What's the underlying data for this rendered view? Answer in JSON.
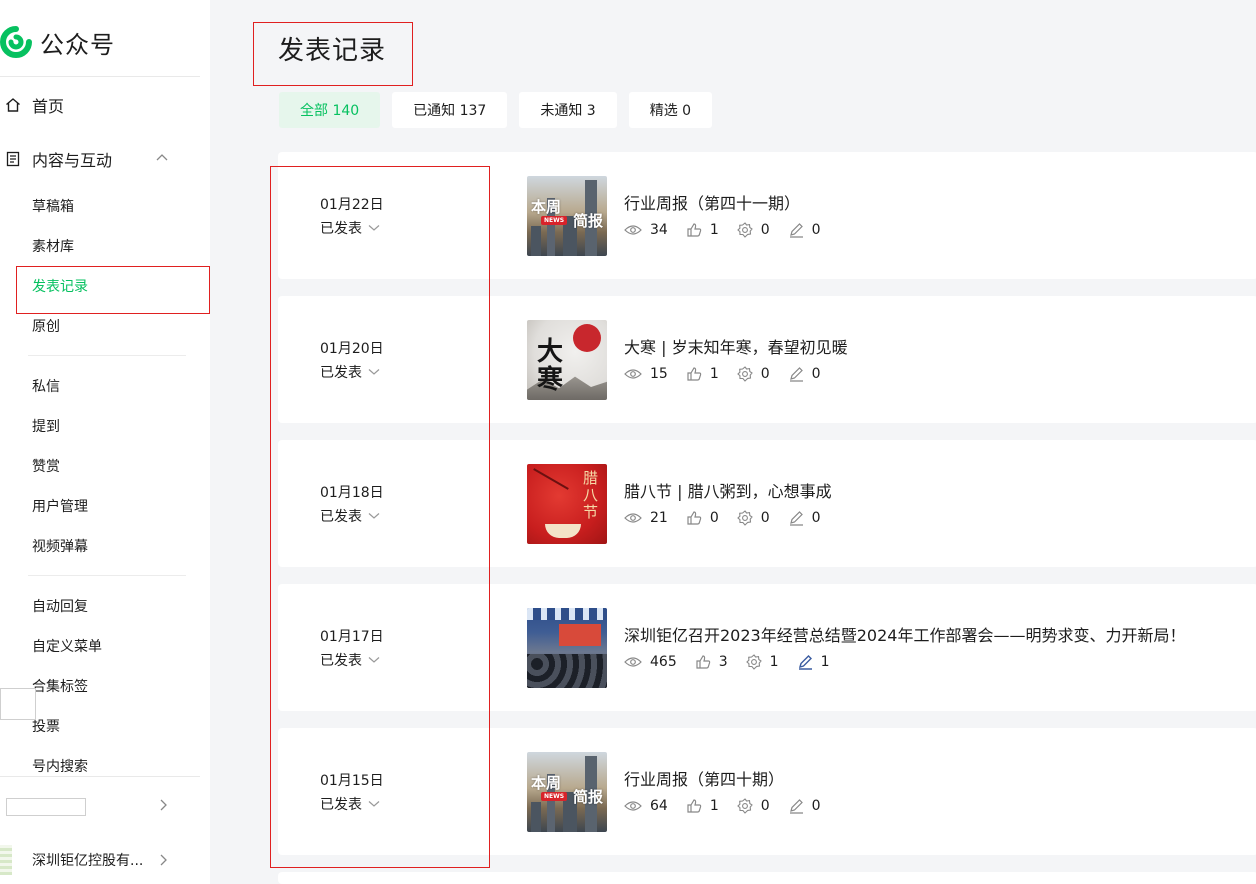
{
  "sidebar": {
    "logo_text": "公众号",
    "home_label": "首页",
    "content_label": "内容与互动",
    "group1": [
      "草稿箱",
      "素材库",
      "发表记录",
      "原创"
    ],
    "group2": [
      "私信",
      "提到",
      "赞赏",
      "用户管理",
      "视频弹幕"
    ],
    "group3": [
      "自动回复",
      "自定义菜单",
      "合集标签",
      "投票",
      "号内搜索"
    ],
    "account_name": "深圳钜亿控股有..."
  },
  "main": {
    "title": "发表记录",
    "tabs": [
      {
        "label": "全部 140",
        "active": true
      },
      {
        "label": "已通知 137",
        "active": false
      },
      {
        "label": "未通知 3",
        "active": false
      },
      {
        "label": "精选 0",
        "active": false
      }
    ],
    "articles": [
      {
        "date": "01月22日",
        "status": "已发表",
        "title": "行业周报（第四十一期）",
        "reads": "34",
        "likes": "1",
        "shares": "0",
        "comments": "0",
        "cover": "weekly-news"
      },
      {
        "date": "01月20日",
        "status": "已发表",
        "title": "大寒 | 岁末知年寒，春望初见暖",
        "reads": "15",
        "likes": "1",
        "shares": "0",
        "comments": "0",
        "cover": "dahan"
      },
      {
        "date": "01月18日",
        "status": "已发表",
        "title": "腊八节 | 腊八粥到，心想事成",
        "reads": "21",
        "likes": "0",
        "shares": "0",
        "comments": "0",
        "cover": "laba"
      },
      {
        "date": "01月17日",
        "status": "已发表",
        "title": "深圳钜亿召开2023年经营总结暨2024年工作部署会——明势求变、力开新局！",
        "reads": "465",
        "likes": "3",
        "shares": "1",
        "comments": "1",
        "cover": "meeting"
      },
      {
        "date": "01月15日",
        "status": "已发表",
        "title": "行业周报（第四十期）",
        "reads": "64",
        "likes": "1",
        "shares": "0",
        "comments": "0",
        "cover": "weekly-news"
      }
    ],
    "cover_text": {
      "weekly_left": "本周",
      "weekly_right": "简报",
      "weekly_badge": "NEWS",
      "dahan": "大寒",
      "laba": "腊八节"
    }
  },
  "colors": {
    "accent_green": "#07c160",
    "highlight_red": "#e02020",
    "active_tab_bg": "#e6f6ec"
  }
}
